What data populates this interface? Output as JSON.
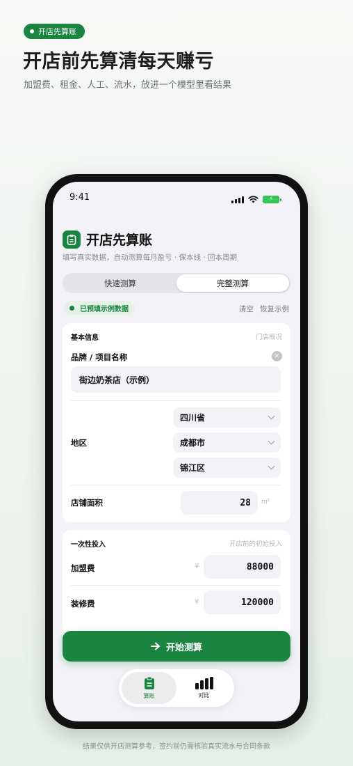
{
  "promo": {
    "tag": "开店先算账",
    "title": "开店前先算清每天赚亏",
    "subtitle": "加盟费、租金、人工、流水，放进一个模型里看结果",
    "footer": "结果仅供开店测算参考，签约前仍需核验真实流水与合同条款"
  },
  "status": {
    "time": "9:41"
  },
  "app": {
    "title": "开店先算账",
    "subtitle": "填写真实数据，自动测算每月盈亏 · 保本线 · 回本周期"
  },
  "segment": {
    "quick": "快速测算",
    "full": "完整测算",
    "selected": "完整测算"
  },
  "prefill": {
    "badge": "已预填示例数据",
    "clear": "清空",
    "restore": "恢复示例"
  },
  "basic": {
    "title": "基本信息",
    "hint": "门店概况",
    "brand_label": "品牌 / 项目名称",
    "brand_value": "街边奶茶店（示例）",
    "region_label": "地区",
    "province": "四川省",
    "city": "成都市",
    "district": "锦江区",
    "area_label": "店铺面积",
    "area_value": "28",
    "area_unit": "m²"
  },
  "onetime": {
    "title": "一次性投入",
    "hint": "开店前的初始投入",
    "currency": "¥",
    "franchise_label": "加盟费",
    "franchise_value": "88000",
    "renovation_label": "装修费",
    "renovation_value": "120000"
  },
  "cta": {
    "label": "开始测算"
  },
  "tabs": {
    "calc": "算账",
    "compare": "对比"
  },
  "colors": {
    "accent": "#1a8440",
    "background": "#f2f2f7"
  }
}
